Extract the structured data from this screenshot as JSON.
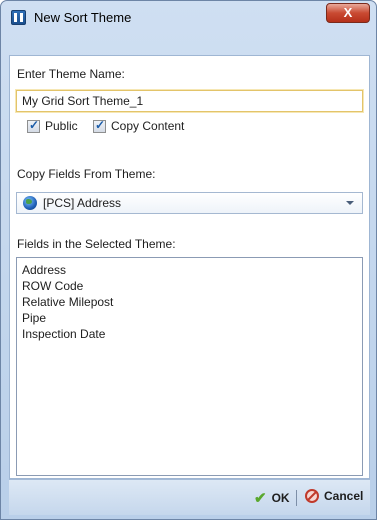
{
  "window": {
    "title": "New Sort Theme",
    "close_glyph": "X"
  },
  "form": {
    "theme_name_label": "Enter Theme Name:",
    "theme_name_value": "My Grid Sort Theme_1",
    "public_label": "Public",
    "public_checked": true,
    "copy_content_label": "Copy Content",
    "copy_content_checked": true,
    "copy_fields_label": "Copy Fields From Theme:",
    "copy_fields_selected": "[PCS] Address",
    "fields_label": "Fields in the Selected Theme:",
    "fields": [
      "Address",
      "ROW Code",
      "Relative Milepost",
      "Pipe",
      "Inspection Date"
    ]
  },
  "footer": {
    "ok_label": "OK",
    "cancel_label": "Cancel"
  },
  "icons": {
    "app": "grid-app-icon",
    "globe": "globe-icon",
    "ok": "check-icon",
    "cancel": "cancel-icon"
  }
}
